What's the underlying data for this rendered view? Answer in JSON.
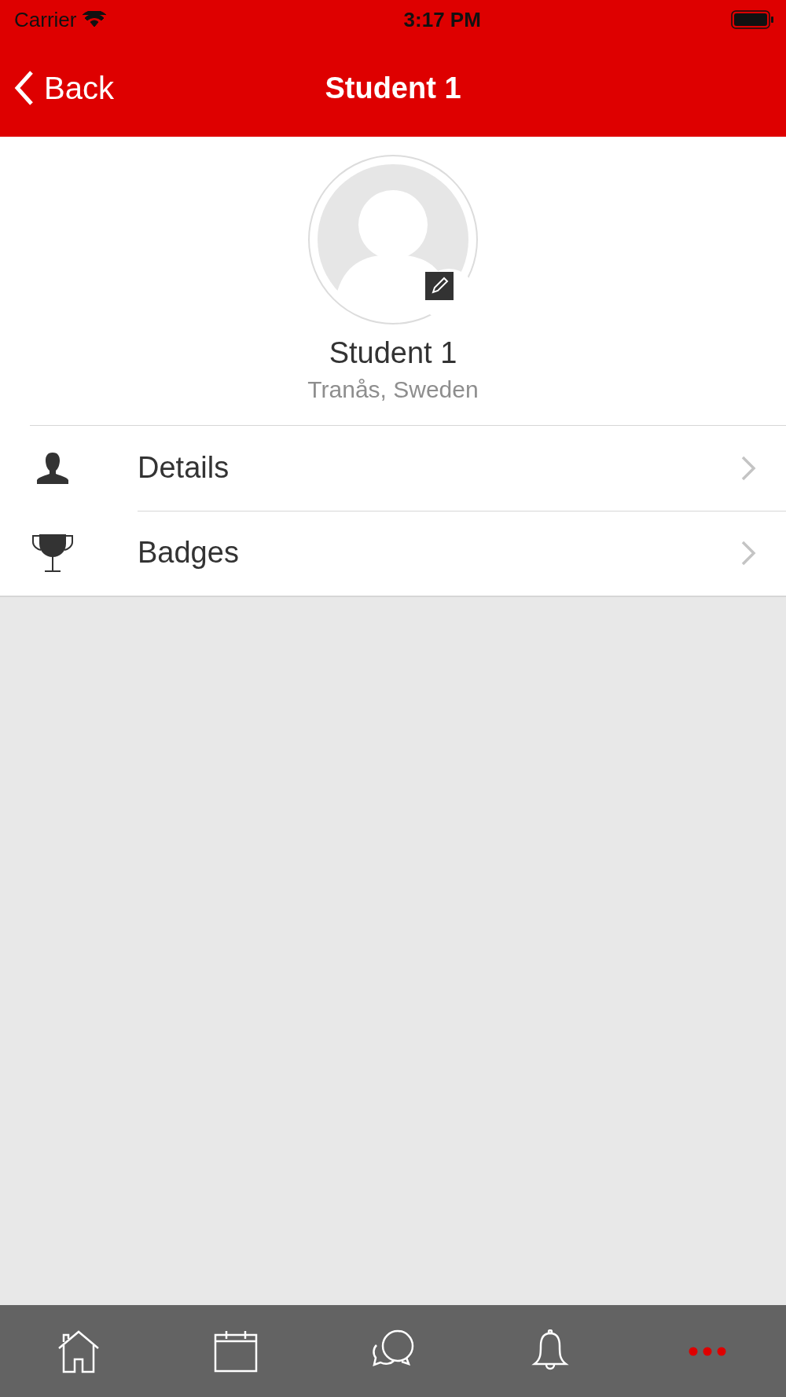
{
  "status_bar": {
    "carrier": "Carrier",
    "time": "3:17 PM"
  },
  "nav_bar": {
    "back": "Back",
    "title": "Student 1"
  },
  "profile": {
    "name": "Student 1",
    "location": "Tranås, Sweden"
  },
  "menu": [
    {
      "kind": "person",
      "label": "Details"
    },
    {
      "kind": "trophy",
      "label": "Badges"
    }
  ],
  "tab_bar": [
    {
      "kind": "home",
      "selected": false
    },
    {
      "kind": "calendar",
      "selected": false
    },
    {
      "kind": "chat",
      "selected": false
    },
    {
      "kind": "bell",
      "selected": false
    },
    {
      "kind": "more",
      "selected": true
    }
  ]
}
